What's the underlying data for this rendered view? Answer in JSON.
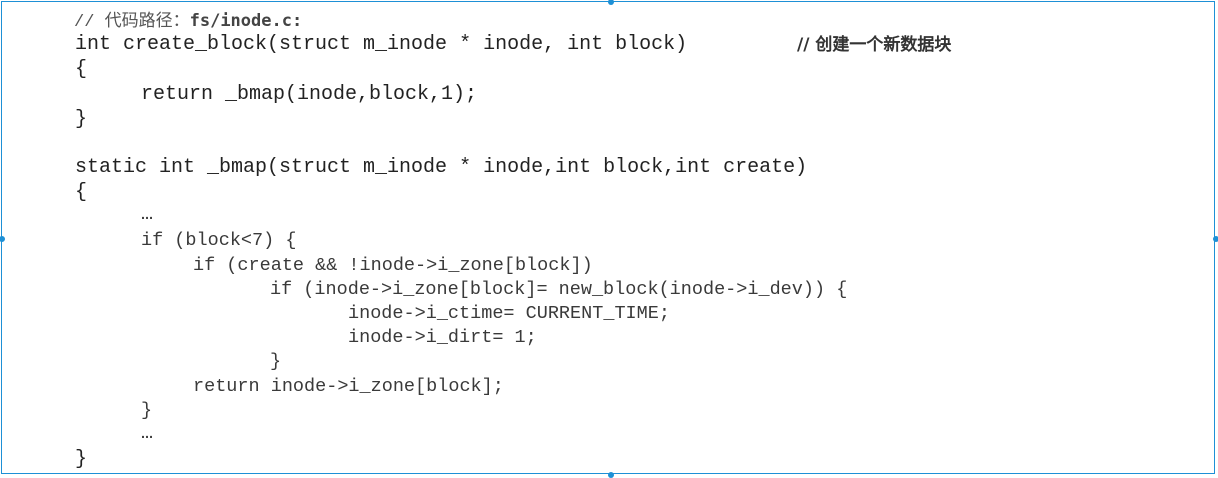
{
  "code": {
    "header_comment": {
      "prefix": "// 代码路径：",
      "path": "fs/inode.c:"
    },
    "lines": [
      "int create_block(struct m_inode * inode, int block)",
      "{",
      "return _bmap(inode,block,1);",
      "}",
      "static int _bmap(struct m_inode * inode,int block,int create)",
      "{",
      "…",
      "if (block<7) {",
      "if (create && !inode->i_zone[block])",
      "if (inode->i_zone[block]= new_block(inode->i_dev)) {",
      "inode->i_ctime= CURRENT_TIME;",
      "inode->i_dirt= 1;",
      "}",
      "return inode->i_zone[block];",
      "}",
      "…",
      "}"
    ],
    "line1_comment": "// 创建一个新数据块"
  }
}
